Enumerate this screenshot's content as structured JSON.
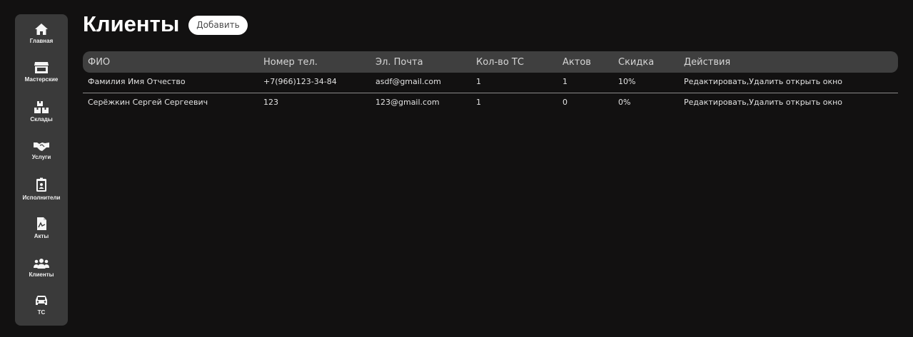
{
  "sidebar": {
    "items": [
      {
        "label": "Главная",
        "icon": "home-icon"
      },
      {
        "label": "Мастерские",
        "icon": "store-icon"
      },
      {
        "label": "Склады",
        "icon": "boxes-icon"
      },
      {
        "label": "Услуги",
        "icon": "handshake-icon"
      },
      {
        "label": "Исполнители",
        "icon": "id-badge-icon"
      },
      {
        "label": "Акты",
        "icon": "document-icon"
      },
      {
        "label": "Клиенты",
        "icon": "users-icon"
      },
      {
        "label": "ТС",
        "icon": "car-icon"
      }
    ]
  },
  "header": {
    "title": "Клиенты",
    "add_label": "Добавить"
  },
  "table": {
    "columns": [
      "ФИО",
      "Номер тел.",
      "Эл. Почта",
      "Кол-во ТС",
      "Актов",
      "Скидка",
      "Действия"
    ],
    "rows": [
      {
        "name": "Фамилия Имя Отчество",
        "phone": "+7(966)123-34-84",
        "email": "asdf@gmail.com",
        "vehicles": "1",
        "acts": "1",
        "discount": "10%",
        "edit": "Редактировать",
        "sep": ",",
        "delete": "Удалить",
        "open": "открыть окно"
      },
      {
        "name": "Серёжкин Сергей Сергеевич",
        "phone": "123",
        "email": "123@gmail.com",
        "vehicles": "1",
        "acts": "0",
        "discount": "0%",
        "edit": "Редактировать",
        "sep": ",",
        "delete": "Удалить",
        "open": "открыть окно"
      }
    ]
  },
  "colors": {
    "background": "#121111",
    "sidebar": "#3a3a3a",
    "table_header": "#3f3f3f"
  }
}
